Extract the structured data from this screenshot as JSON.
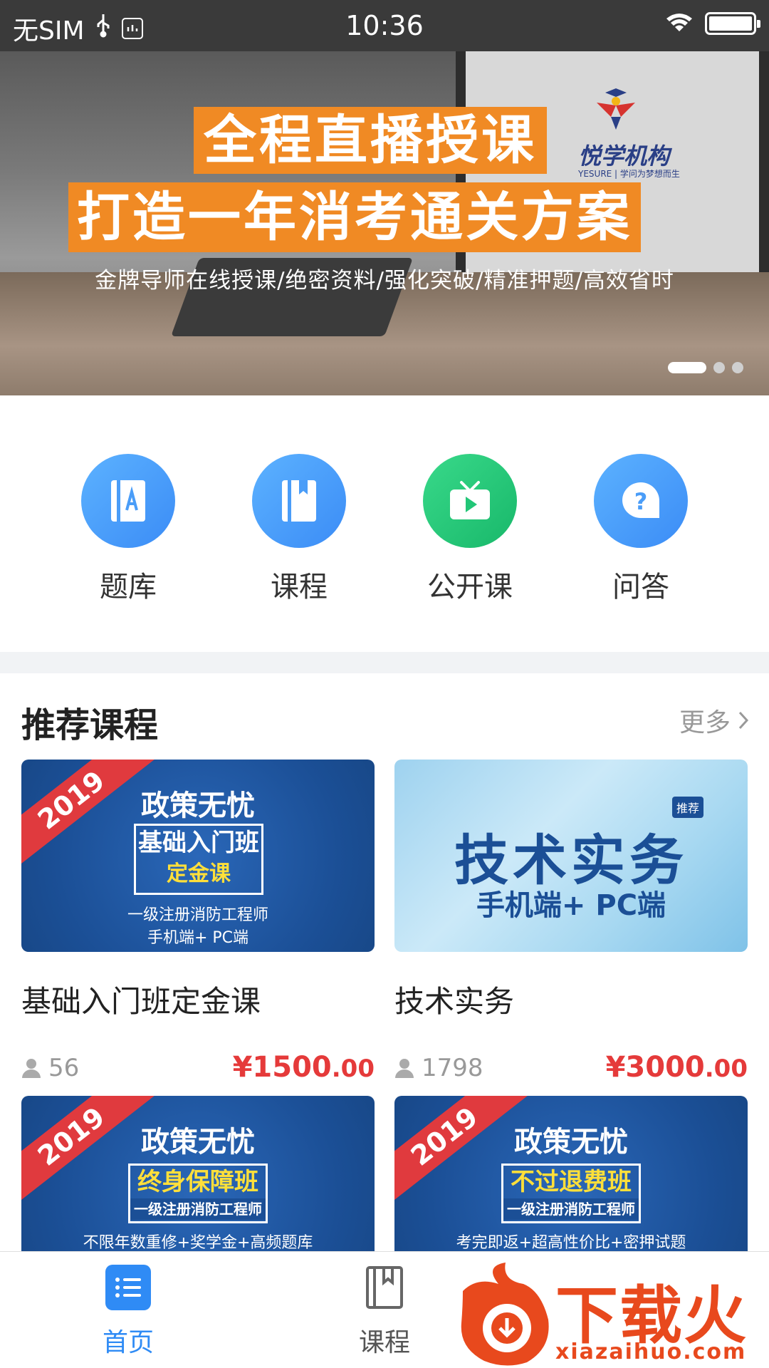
{
  "status_bar": {
    "carrier": "无SIM",
    "time": "10:36"
  },
  "banner": {
    "headline_1": "全程直播授课",
    "headline_2": "打造一年消考通关方案",
    "subtitle": "金牌导师在线授课/绝密资料/强化突破/精准押题/高效省时",
    "logo_text": "悦学机构",
    "logo_sub": "YESURE | 学问为梦想而生",
    "slides_total": 3,
    "active_slide": 1,
    "accent_color": "#f08a24"
  },
  "quick_nav": [
    {
      "label": "题库",
      "icon": "question-bank-icon",
      "color": "#4a9df8"
    },
    {
      "label": "课程",
      "icon": "course-book-icon",
      "color": "#4a9df8"
    },
    {
      "label": "公开课",
      "icon": "tv-play-icon",
      "color": "#22c677"
    },
    {
      "label": "问答",
      "icon": "question-bubble-icon",
      "color": "#4a9df8"
    }
  ],
  "recommend": {
    "title": "推荐课程",
    "more_label": "更多",
    "courses": [
      {
        "name": "基础入门班定金课",
        "students": "56",
        "price_main": "¥1500",
        "price_cents": ".00",
        "thumb": {
          "ribbon": "2019",
          "title": "政策无忧",
          "box_line_1": "基础入门班",
          "box_line_2": "定金课",
          "line_1": "一级注册消防工程师",
          "line_2": "手机端+ PC端"
        }
      },
      {
        "name": "技术实务",
        "students": "1798",
        "price_main": "¥3000",
        "price_cents": ".00",
        "thumb": {
          "big_title": "技术实务",
          "tag": "推荐",
          "line": "手机端+ PC端"
        }
      },
      {
        "thumb": {
          "ribbon": "2019",
          "title": "政策无忧",
          "box_line_1": "终身保障班",
          "box_line_2": "一级注册消防工程师",
          "line": "不限年数重修+奖学金+高频题库"
        }
      },
      {
        "thumb": {
          "ribbon": "2019",
          "title": "政策无忧",
          "box_line_1": "不过退费班",
          "box_line_2": "一级注册消防工程师",
          "line": "考完即返+超高性价比+密押试题"
        }
      }
    ]
  },
  "tab_bar": {
    "tabs": [
      {
        "label": "首页",
        "icon": "list-icon",
        "active": true
      },
      {
        "label": "课程",
        "icon": "book-icon",
        "active": false
      }
    ],
    "active_color": "#2f8bf5"
  },
  "watermark": {
    "text": "下载火",
    "sub": "xiazaihuo.com"
  }
}
